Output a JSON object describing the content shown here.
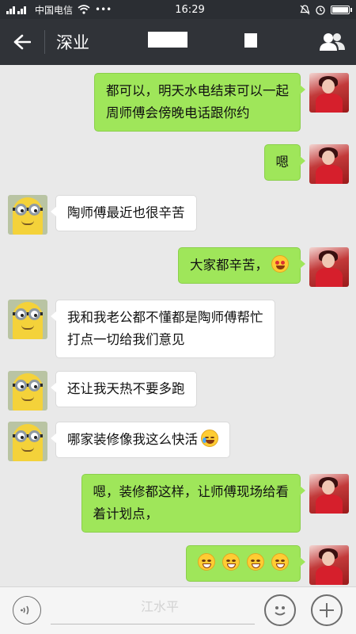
{
  "status_bar": {
    "carrier": "中国电信",
    "network": "4G",
    "time": "16:29"
  },
  "header": {
    "title": "深业"
  },
  "messages": [
    {
      "side": "self",
      "lines": [
        "都可以，明天水电结束可以一起",
        "周师傅会傍晚电话跟你约"
      ]
    },
    {
      "side": "self",
      "lines": [
        "嗯"
      ]
    },
    {
      "side": "other",
      "lines": [
        "陶师傅最近也很辛苦"
      ]
    },
    {
      "side": "self",
      "lines": [
        "大家都辛苦，"
      ],
      "emoji": "heart-eyes-emoji-icon"
    },
    {
      "side": "other",
      "lines": [
        "我和我老公都不懂都是陶师傅帮忙",
        "打点一切给我们意见"
      ]
    },
    {
      "side": "other",
      "lines": [
        "还让我天热不要多跑"
      ]
    },
    {
      "side": "other",
      "lines": [
        "哪家装修像我这么快活"
      ],
      "emoji": "laughing-tears-emoji-icon"
    },
    {
      "side": "self",
      "lines": [
        "嗯，装修都这样，让师傅现场给看",
        "着计划点，"
      ]
    },
    {
      "side": "self",
      "emojis": [
        "grin-emoji-icon",
        "grin-emoji-icon",
        "grin-emoji-icon",
        "grin-emoji-icon"
      ]
    }
  ],
  "watermark": "江水平",
  "colors": {
    "self_bubble": "#9fe65a",
    "other_bubble": "#ffffff",
    "header_bg": "#303338",
    "chat_bg": "#e9e9e9"
  }
}
